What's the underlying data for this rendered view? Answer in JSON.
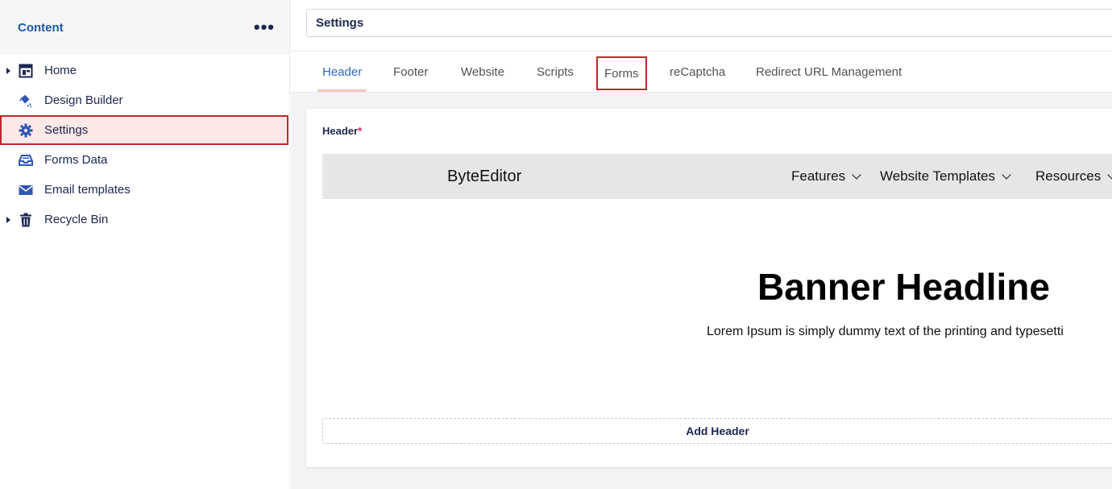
{
  "sidebar": {
    "title": "Content",
    "more_label": "•••",
    "items": [
      {
        "label": "Home",
        "icon": "home-layout-icon",
        "expandable": true
      },
      {
        "label": "Design Builder",
        "icon": "paint-bucket-icon",
        "expandable": false
      },
      {
        "label": "Settings",
        "icon": "gear-icon",
        "expandable": false,
        "active": true
      },
      {
        "label": "Forms Data",
        "icon": "inbox-icon",
        "expandable": false
      },
      {
        "label": "Email templates",
        "icon": "envelope-icon",
        "expandable": false
      },
      {
        "label": "Recycle Bin",
        "icon": "trash-icon",
        "expandable": true
      }
    ]
  },
  "main": {
    "title": "Settings",
    "tabs": [
      {
        "label": "Header",
        "active": true
      },
      {
        "label": "Footer"
      },
      {
        "label": "Website"
      },
      {
        "label": "Scripts"
      },
      {
        "label": "Forms",
        "highlighted": true
      },
      {
        "label": "reCaptcha"
      },
      {
        "label": "Redirect URL Management"
      }
    ],
    "field_label": "Header",
    "required_mark": "*",
    "preview": {
      "brand": "ByteEditor",
      "nav": [
        "Features",
        "Website Templates",
        "Resources"
      ],
      "headline": "Banner Headline",
      "text": "Lorem Ipsum is simply dummy text of the printing and typesetti"
    },
    "add_button": "Add Header"
  },
  "colors": {
    "accent_blue": "#2b6bc4",
    "highlight_red": "#c0272d",
    "active_bg": "#fde8e8",
    "icon_blue": "#2f55b5"
  }
}
